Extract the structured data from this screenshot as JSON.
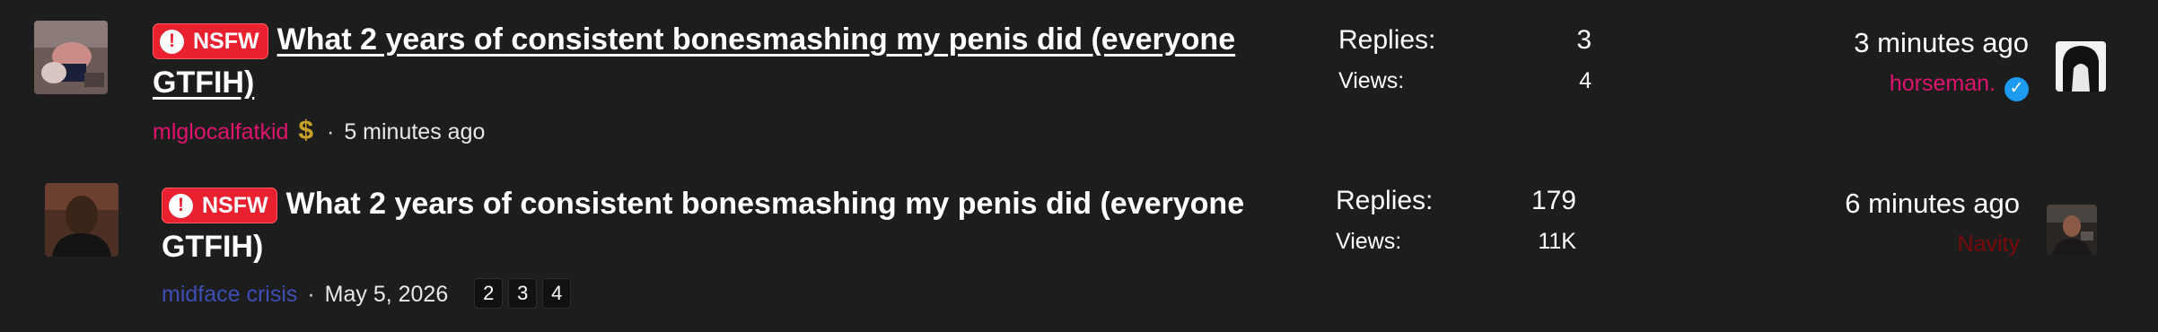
{
  "threads": [
    {
      "badge": "NSFW",
      "title": "What 2 years of consistent bonesmashing my penis did (everyone GTFIH)",
      "author": "mlglocalfatkid",
      "author_badge": "$",
      "date": "5 minutes ago",
      "pages": [],
      "replies_label": "Replies:",
      "replies": "3",
      "views_label": "Views:",
      "views": "4",
      "last_time": "3 minutes ago",
      "last_user": "horseman.",
      "last_user_verified": true,
      "colors": {
        "author": "#e0136d",
        "last_user": "#e0136d"
      }
    },
    {
      "badge": "NSFW",
      "title": "What 2 years of consistent bonesmashing my penis did (everyone GTFIH)",
      "author": "midface crisis",
      "date": "May 5, 2026",
      "pages": [
        "2",
        "3",
        "4"
      ],
      "replies_label": "Replies:",
      "replies": "179",
      "views_label": "Views:",
      "views": "11K",
      "last_time": "6 minutes ago",
      "last_user": "Navity",
      "last_user_verified": false,
      "colors": {
        "author": "#3d4eb5",
        "last_user": "#7a0a0a"
      }
    }
  ],
  "icons": {
    "nsfw": "exclamation-circle-icon",
    "verified": "checkmark-badge-icon"
  },
  "colors": {
    "background": "#1d1d1e",
    "nsfw_badge": "#e8202f",
    "verified": "#1d9bf0"
  }
}
